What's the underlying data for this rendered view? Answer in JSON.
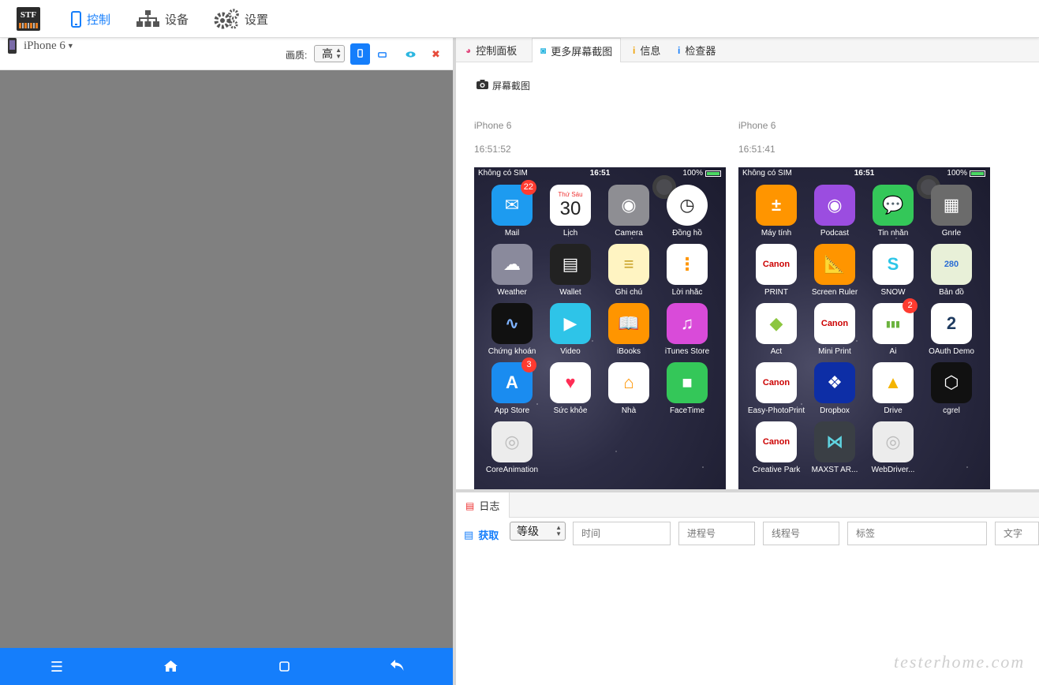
{
  "nav": {
    "logo_text": "STF",
    "items": [
      {
        "label": "控制",
        "icon": "phone-icon",
        "active": true
      },
      {
        "label": "设备",
        "icon": "sitemap-icon",
        "active": false
      },
      {
        "label": "设置",
        "icon": "gears-icon",
        "active": false
      }
    ]
  },
  "device": {
    "name": "iPhone 6",
    "quality_label": "画质:",
    "quality_value": "高",
    "toolbar_icons": [
      "portrait-icon",
      "landscape-icon",
      "eye-icon",
      "close-icon"
    ]
  },
  "bottom_bar": {
    "icons": [
      "menu-icon",
      "home-icon",
      "square-icon",
      "back-icon"
    ]
  },
  "tabs": [
    {
      "label": "控制面板",
      "icon": "dashboard-icon"
    },
    {
      "label": "更多屏幕截图",
      "icon": "camera-icon",
      "active": true
    },
    {
      "label": "信息",
      "icon": "info-icon"
    },
    {
      "label": "检查器",
      "icon": "info-icon"
    }
  ],
  "screenshots": {
    "take_label": "屏幕截图",
    "items": [
      {
        "device": "iPhone 6",
        "time": "16:51:52",
        "status": {
          "carrier": "Không có SIM",
          "time": "16:51",
          "battery": "100%",
          "battery_level": 1.0
        },
        "apps": [
          {
            "label": "Mail",
            "badge": "22",
            "color": "#1d9bf0",
            "glyph": "✉"
          },
          {
            "label": "Lịch",
            "color": "#ffffff",
            "glyph": "30",
            "fg": "#222",
            "sub": "Thứ Sáu"
          },
          {
            "label": "Camera",
            "color": "#8e8e93",
            "glyph": "◉"
          },
          {
            "label": "Đồng hồ",
            "color": "#ffffff",
            "glyph": "◷",
            "fg": "#222",
            "round": true
          },
          {
            "label": "Weather",
            "color": "#8a8a9c",
            "glyph": "☁"
          },
          {
            "label": "Wallet",
            "color": "#222222",
            "glyph": "▤"
          },
          {
            "label": "Ghi chú",
            "color": "#fff4c2",
            "glyph": "≡",
            "fg": "#c9a227"
          },
          {
            "label": "Lời nhắc",
            "color": "#ffffff",
            "glyph": "⋮",
            "fg": "#ff9500"
          },
          {
            "label": "Chứng khoán",
            "color": "#111111",
            "glyph": "∿",
            "fg": "#7fb3ff"
          },
          {
            "label": "Video",
            "color": "#2ec4e8",
            "glyph": "▶"
          },
          {
            "label": "iBooks",
            "color": "#ff9500",
            "glyph": "📖"
          },
          {
            "label": "iTunes Store",
            "color": "#d94bd9",
            "glyph": "♫"
          },
          {
            "label": "App Store",
            "badge": "3",
            "color": "#1a8cf0",
            "glyph": "A"
          },
          {
            "label": "Sức khỏe",
            "color": "#ffffff",
            "glyph": "♥",
            "fg": "#ff2d55"
          },
          {
            "label": "Nhà",
            "color": "#ffffff",
            "glyph": "⌂",
            "fg": "#ff9500"
          },
          {
            "label": "FaceTime",
            "color": "#34c759",
            "glyph": "■"
          },
          {
            "label": "CoreAnimation",
            "color": "#ececec",
            "glyph": "◎",
            "fg": "#bbb"
          }
        ]
      },
      {
        "device": "iPhone 6",
        "time": "16:51:41",
        "status": {
          "carrier": "Không có SIM",
          "time": "16:51",
          "battery": "100%",
          "battery_level": 1.0
        },
        "apps": [
          {
            "label": "Máy tính",
            "color": "#ff9500",
            "glyph": "±"
          },
          {
            "label": "Podcast",
            "color": "#9b4de0",
            "glyph": "◉"
          },
          {
            "label": "Tin nhắn",
            "color": "#34c759",
            "glyph": "💬"
          },
          {
            "label": "Gnrle",
            "color": "#6b6b6b",
            "glyph": "▦"
          },
          {
            "label": "PRINT",
            "color": "#ffffff",
            "glyph": "Canon",
            "fg": "#cc0000",
            "small": true
          },
          {
            "label": "Screen Ruler",
            "color": "#ff9500",
            "glyph": "📐"
          },
          {
            "label": "SNOW",
            "color": "#ffffff",
            "glyph": "S",
            "fg": "#2dc6e8"
          },
          {
            "label": "Bản đồ",
            "color": "#e8f0d8",
            "glyph": "280",
            "fg": "#2a6cd4",
            "small": true
          },
          {
            "label": "Act",
            "color": "#ffffff",
            "glyph": "◆",
            "fg": "#8cc63f"
          },
          {
            "label": "Mini Print",
            "color": "#ffffff",
            "glyph": "Canon",
            "fg": "#cc0000",
            "small": true
          },
          {
            "label": "Ai",
            "badge": "2",
            "color": "#ffffff",
            "glyph": "▮▮▮",
            "fg": "#6cb33f",
            "small": true
          },
          {
            "label": "OAuth Demo",
            "color": "#ffffff",
            "glyph": "2",
            "fg": "#1e3a5f"
          },
          {
            "label": "Easy-PhotoPrint",
            "color": "#ffffff",
            "glyph": "Canon",
            "fg": "#cc0000",
            "small": true
          },
          {
            "label": "Dropbox",
            "color": "#0d2ea6",
            "glyph": "❖"
          },
          {
            "label": "Drive",
            "color": "#ffffff",
            "glyph": "▲",
            "fg": "#f4b400"
          },
          {
            "label": "cgrel",
            "color": "#111111",
            "glyph": "⬡"
          },
          {
            "label": "Creative Park",
            "color": "#ffffff",
            "glyph": "Canon",
            "fg": "#cc0000",
            "small": true
          },
          {
            "label": "MAXST AR...",
            "color": "#3a3f45",
            "glyph": "⋈",
            "fg": "#5fd3e0"
          },
          {
            "label": "WebDriver...",
            "color": "#ececec",
            "glyph": "◎",
            "fg": "#bbb"
          }
        ]
      }
    ]
  },
  "logs": {
    "tab_label": "日志",
    "get_label": "获取",
    "level_value": "等级",
    "filters": [
      "时间",
      "进程号",
      "线程号",
      "标签",
      "文字"
    ]
  },
  "watermark": "testerhome.com"
}
